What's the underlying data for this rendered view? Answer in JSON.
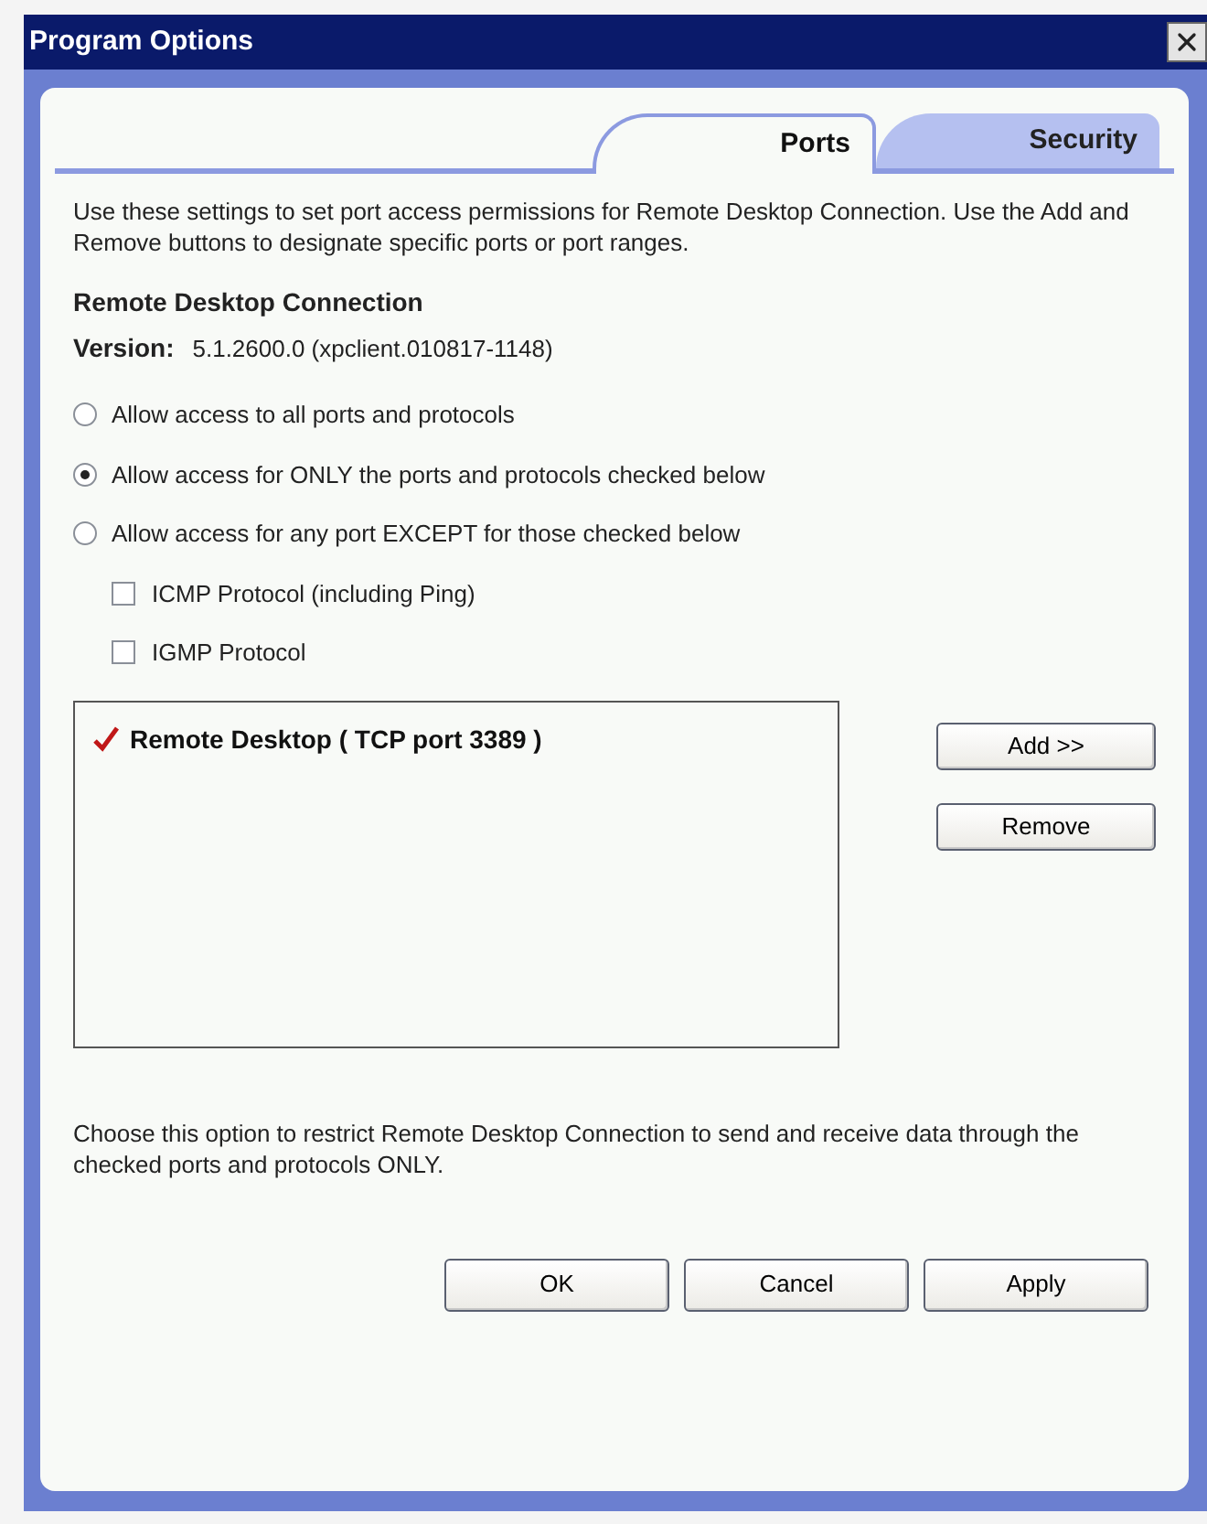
{
  "window": {
    "title": "Program Options"
  },
  "tabs": [
    {
      "label": "Ports",
      "selected": true
    },
    {
      "label": "Security",
      "selected": false
    }
  ],
  "intro": "Use these settings to set port access permissions for Remote Desktop Connection.  Use the Add and Remove buttons to designate specific ports or port ranges.",
  "program": {
    "name": "Remote Desktop Connection",
    "version_label": "Version:",
    "version": "5.1.2600.0 (xpclient.010817-1148)"
  },
  "access_options": [
    {
      "label": "Allow access to all ports and protocols",
      "selected": false
    },
    {
      "label": "Allow access for ONLY the ports and protocols checked below",
      "selected": true
    },
    {
      "label": "Allow access for any port EXCEPT for those checked below",
      "selected": false
    }
  ],
  "protocols": [
    {
      "label": "ICMP Protocol (including Ping)",
      "checked": false
    },
    {
      "label": "IGMP Protocol",
      "checked": false
    }
  ],
  "ports": [
    {
      "label": "Remote Desktop ( TCP port 3389 )",
      "checked": true
    }
  ],
  "side_buttons": [
    "Add >>",
    "Remove"
  ],
  "note": "Choose this option to restrict Remote Desktop Connection to send and receive data through the checked ports and protocols ONLY.",
  "buttons": [
    "OK",
    "Cancel",
    "Apply"
  ]
}
